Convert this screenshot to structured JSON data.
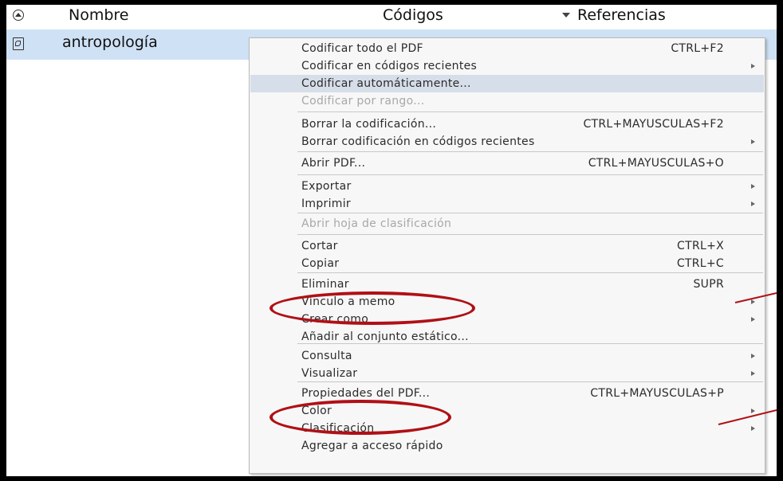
{
  "header": {
    "name_label": "Nombre",
    "codes_label": "Códigos",
    "references_label": "Referencias"
  },
  "row": {
    "label": "antropología"
  },
  "menu": {
    "items": [
      {
        "label": "Codificar todo el PDF",
        "shortcut": "CTRL+F2"
      },
      {
        "label": "Codificar en códigos recientes",
        "submenu": true
      },
      {
        "label": "Codificar automáticamente...",
        "highlighted": true
      },
      {
        "label": "Codificar por rango...",
        "disabled": true
      },
      {
        "label": "Borrar la codificación...",
        "shortcut": "CTRL+MAYUSCULAS+F2"
      },
      {
        "label": "Borrar codificación en códigos recientes",
        "submenu": true
      },
      {
        "label": "Abrir PDF...",
        "shortcut": "CTRL+MAYUSCULAS+O"
      },
      {
        "label": "Exportar",
        "submenu": true
      },
      {
        "label": "Imprimir",
        "submenu": true
      },
      {
        "label": "Abrir hoja de clasificación",
        "disabled": true
      },
      {
        "label": "Cortar",
        "shortcut": "CTRL+X"
      },
      {
        "label": "Copiar",
        "shortcut": "CTRL+C"
      },
      {
        "label": "Eliminar",
        "shortcut": "SUPR"
      },
      {
        "label": "Vínculo a memo",
        "submenu": true
      },
      {
        "label": "Crear como",
        "submenu": true
      },
      {
        "label": "Añadir al conjunto estático..."
      },
      {
        "label": "Consulta",
        "submenu": true
      },
      {
        "label": "Visualizar",
        "submenu": true
      },
      {
        "label": "Propiedades del PDF...",
        "shortcut": "CTRL+MAYUSCULAS+P"
      },
      {
        "label": "Color",
        "submenu": true
      },
      {
        "label": "Clasificación",
        "submenu": true
      },
      {
        "label": "Agregar a acceso rápido"
      }
    ]
  },
  "annotation_color": "#b01016",
  "highlight_color": "#d6dee9",
  "row_selected_color": "#cfe1f5"
}
